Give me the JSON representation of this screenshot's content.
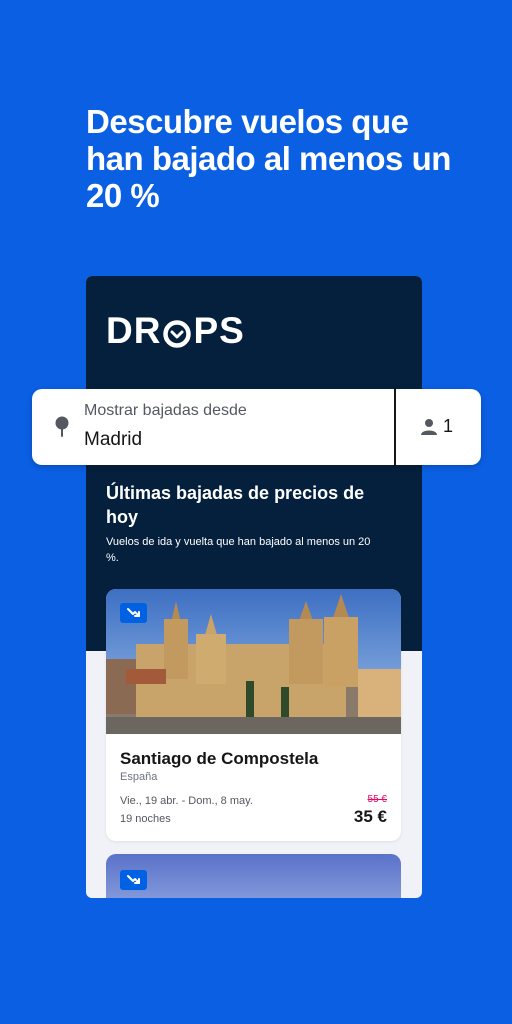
{
  "headline": "Descubre vuelos que han bajado al menos un 20 %",
  "brand": {
    "logo_text_left": "DR",
    "logo_text_right": "PS"
  },
  "search": {
    "label": "Mostrar bajadas desde",
    "value": "Madrid",
    "travellers": "1"
  },
  "section": {
    "title": "Últimas bajadas de precios de hoy",
    "subtitle": "Vuelos de ida y vuelta que han bajado al menos un 20 %."
  },
  "deals": [
    {
      "title": "Santiago de Compostela",
      "country": "España",
      "dates": "Vie., 19 abr. - Dom., 8 may.",
      "nights": "19 noches",
      "old_price": "55 €",
      "price": "35 €"
    }
  ],
  "colors": {
    "background": "#0a5fe3",
    "dark_panel": "#05203c",
    "badge": "#0062e3",
    "old_price": "#e70866"
  },
  "icons": [
    "location-pin-icon",
    "person-icon",
    "price-drop-icon",
    "drops-logo-arrow-icon"
  ]
}
